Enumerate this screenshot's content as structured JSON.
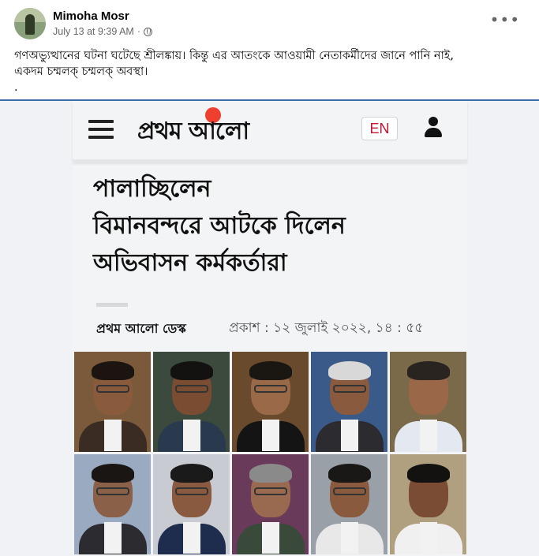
{
  "post": {
    "author": "Mimoha Mosr",
    "timestamp": "July 13 at 9:39 AM",
    "separator": "·",
    "more_label": "•••",
    "caption_lines": [
      "গণঅভ্যুত্থানের ঘটনা ঘটেছে শ্রীলঙ্কায়। কিন্তু এর আতংকে আওয়ামী নেতাকর্মীদের জানে পানি নাই,",
      "একদম চম্মলক্ চম্মলক্ অবস্থা।",
      "."
    ]
  },
  "article": {
    "logo_text": "প্রথম আলো",
    "lang_button": "EN",
    "headline_lines": [
      "পালাচ্ছিলেন",
      "বিমানবন্দরে আটকে দিলেন",
      "অভিবাসন কর্মকর্তারা"
    ],
    "byline": "প্রথম আলো ডেস্ক",
    "published": "প্রকাশ : ১২ জুলাই ২০২২, ১৪ : ৫৫"
  },
  "colors": {
    "accent": "#3b6ea8",
    "logo_sun": "#ef3f2e",
    "en_text": "#c4122f"
  },
  "photos": [
    {
      "bg": "#7a5a3a",
      "skin": "#8a5a3c",
      "hair": "#1b1410",
      "suit": "#3a2c22",
      "glasses": true
    },
    {
      "bg": "#3c4a3e",
      "skin": "#7a4c32",
      "hair": "#141210",
      "suit": "#2a3a4e",
      "glasses": true
    },
    {
      "bg": "#6a4a2c",
      "skin": "#9a6a48",
      "hair": "#1a1612",
      "suit": "#141414",
      "glasses": true
    },
    {
      "bg": "#3a5a8a",
      "skin": "#8a5a3e",
      "hair": "#d8d8d8",
      "suit": "#2c2c30",
      "glasses": true
    },
    {
      "bg": "#7a6a4a",
      "skin": "#9a6848",
      "hair": "#2a2420",
      "suit": "#e4e8f0",
      "glasses": false
    },
    {
      "bg": "#9aaac0",
      "skin": "#8a6048",
      "hair": "#1a1614",
      "suit": "#2c2c30",
      "glasses": true
    },
    {
      "bg": "#c8ccd2",
      "skin": "#8a5a40",
      "hair": "#1a1a1a",
      "suit": "#1e2c4e",
      "glasses": true
    },
    {
      "bg": "#6a3a5a",
      "skin": "#9a6a50",
      "hair": "#8a8a8a",
      "suit": "#3a4a3a",
      "glasses": true
    },
    {
      "bg": "#9aa0a8",
      "skin": "#8a5a3e",
      "hair": "#1a1816",
      "suit": "#e8e8e8",
      "glasses": true
    },
    {
      "bg": "#b0a080",
      "skin": "#7a4c34",
      "hair": "#141210",
      "suit": "#f0f0f0",
      "glasses": false
    }
  ]
}
